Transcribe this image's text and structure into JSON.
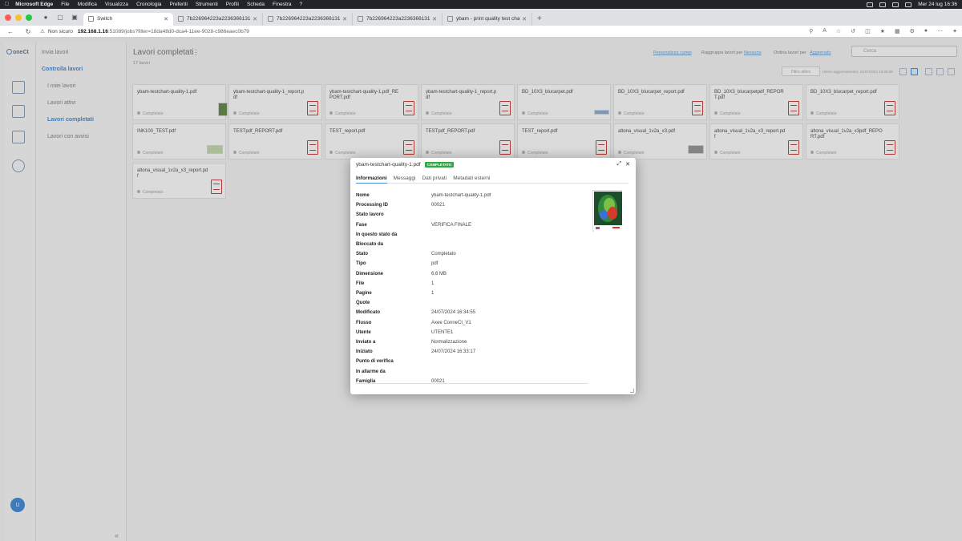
{
  "menubar": {
    "app_name": "Microsoft Edge",
    "items": [
      "File",
      "Modifica",
      "Visualizza",
      "Cronologia",
      "Preferiti",
      "Strumenti",
      "Profili",
      "Scheda",
      "Finestra",
      "?"
    ],
    "datetime": "Mer 24 lug  16:36"
  },
  "tabs": [
    {
      "label": "Switch",
      "active": true
    },
    {
      "label": "7b226964223a22363661313...",
      "active": false
    },
    {
      "label": "7b226964223a22363661313...",
      "active": false
    },
    {
      "label": "7b226964223a22363661313...",
      "active": false
    },
    {
      "label": "ybam - print quality test chart...",
      "active": false
    }
  ],
  "address": {
    "security_label": "Non sicuro",
    "host": "192.168.1.16",
    "path": ":51089/jobs?filter=18da48d0-dca4-11ee-9028-c986eaec0b79"
  },
  "app": {
    "logo_text": "oneCt",
    "avatar_initial": "U",
    "subnav": {
      "submit": "Invia lavori",
      "check_section": "Controlla lavori",
      "my_jobs": "I miei lavori",
      "active_jobs": "Lavori attivi",
      "completed_jobs": "Lavori completati",
      "jobs_with_alerts": "Lavori con avvisi"
    },
    "content": {
      "title": "Lavori completati",
      "count": "17 lavori",
      "customize_fields": "Personalizza campi",
      "group_by": "Raggruppa lavori per",
      "group_by_value": "Nessuno",
      "sort_by": "Ordina lavori per",
      "sort_by_value": "Aggiornato",
      "search_placeholder": "Cerca",
      "filter_label": "Filtro attivo",
      "last_update": "Ultimo aggiornamento: 24/07/2024 16:36:58"
    }
  },
  "jobs": [
    {
      "name": "ybam-testchart-quality-1.pdf",
      "status": "Completato",
      "thumb": "image-green"
    },
    {
      "name": "ybam-testchart-quality-1_report.pdf",
      "status": "Completato",
      "thumb": "pdf-icon"
    },
    {
      "name": "ybam-testchart-quality-1.pdf_REPORT.pdf",
      "status": "Completato",
      "thumb": "pdf-icon"
    },
    {
      "name": "ybam-testchart-quality-1_report.pdf",
      "status": "Completato",
      "thumb": "pdf-icon"
    },
    {
      "name": "BD_10X3_blucarpet.pdf",
      "status": "Completato",
      "thumb": "image-blue"
    },
    {
      "name": "BD_10X3_blucarpet_report.pdf",
      "status": "Completato",
      "thumb": "pdf-icon"
    },
    {
      "name": "BD_10X3_blucarpetpdf_REPORT.pdf",
      "status": "Completato",
      "thumb": "pdf-icon"
    },
    {
      "name": "BD_10X3_blucarpet_report.pdf",
      "status": "Completato",
      "thumb": "pdf-icon"
    },
    {
      "name": "INK100_TEST.pdf",
      "status": "Completato",
      "thumb": "image-light"
    },
    {
      "name": "TESTpdf_REPORT.pdf",
      "status": "Completato",
      "thumb": "pdf-icon"
    },
    {
      "name": "TEST_report.pdf",
      "status": "Completato",
      "thumb": "pdf-icon"
    },
    {
      "name": "TESTpdf_REPORT.pdf",
      "status": "Completato",
      "thumb": "pdf-icon"
    },
    {
      "name": "TEST_report.pdf",
      "status": "Completato",
      "thumb": "pdf-icon"
    },
    {
      "name": "altona_visual_1v2a_x3.pdf",
      "status": "Completato",
      "thumb": "image-gray"
    },
    {
      "name": "altona_visual_1v2a_x3_report.pdf",
      "status": "Completato",
      "thumb": "pdf-icon"
    },
    {
      "name": "altona_visual_1v2a_x3pdf_REPORT.pdf",
      "status": "Completato",
      "thumb": "pdf-icon"
    },
    {
      "name": "altona_visual_1v2a_x3_report.pdf",
      "status": "Completato",
      "thumb": "pdf-icon"
    }
  ],
  "modal": {
    "title": "ybam-testchart-quality-1.pdf",
    "badge": "COMPLETATO",
    "badge_color": "#2eaa3e",
    "tabs": [
      "Informazioni",
      "Messaggi",
      "Dati privati",
      "Metadati esterni"
    ],
    "rows": [
      {
        "label": "Nome",
        "value": "ybam-testchart-quality-1.pdf"
      },
      {
        "label": "Processing ID",
        "value": "00021"
      },
      {
        "label": "Stato lavoro",
        "value": ""
      },
      {
        "label": "Fase",
        "value": "VERIFICA FINALE"
      },
      {
        "label": "In questo stato da",
        "value": ""
      },
      {
        "label": "Bloccato da",
        "value": ""
      },
      {
        "label": "Stato",
        "value": "Completato"
      },
      {
        "label": "Tipo",
        "value": "pdf"
      },
      {
        "label": "Dimensione",
        "value": "6.6 MB"
      },
      {
        "label": "File",
        "value": "1"
      },
      {
        "label": "Pagine",
        "value": "1"
      },
      {
        "label": "Quote",
        "value": ""
      },
      {
        "label": "Modificato",
        "value": "24/07/2024 16:34:55"
      },
      {
        "label": "Flusso",
        "value": "Axee ConneCt_V1"
      },
      {
        "label": "Utente",
        "value": "UTENTE1"
      },
      {
        "label": "Inviato a",
        "value": "Normalizzazione"
      },
      {
        "label": "Iniziato",
        "value": "24/07/2024 16:33:17"
      },
      {
        "label": "Punto di verifica",
        "value": ""
      },
      {
        "label": "In allarme da",
        "value": ""
      },
      {
        "label": "Famiglia",
        "value": "00021"
      }
    ]
  },
  "colors": {
    "accent": "#4a90d9",
    "pdf_icon": "#cc4444"
  }
}
